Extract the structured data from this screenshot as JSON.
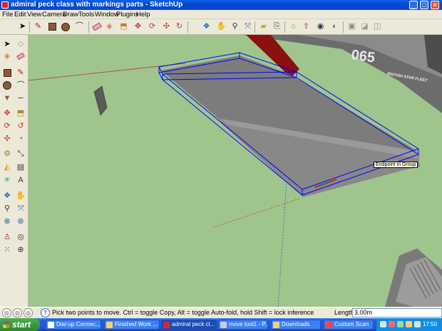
{
  "window": {
    "title": "admiral peck class with markings parts - SketchUp",
    "minimize": "_",
    "maximize": "□",
    "close": "✕"
  },
  "menu": [
    "File",
    "Edit",
    "View",
    "Camera",
    "Draw",
    "Tools",
    "Window",
    "Plugins",
    "Help"
  ],
  "toolbar": {
    "icons": [
      "select-icon",
      "pencil-line-icon",
      "rectangle-icon",
      "circle-icon",
      "arc-icon",
      "eraser-icon",
      "paint-bucket-icon",
      "push-pull-icon",
      "move-icon",
      "rotate-icon",
      "follow-me-icon",
      "orbit-icon",
      "pan-icon",
      "zoom-icon",
      "zoom-extents-icon",
      "open-icon",
      "save-icon",
      "get-models-icon",
      "share-model-icon",
      "google-earth-icon",
      "component-icon",
      "style-icon"
    ]
  },
  "left_toolbar": {
    "icons": [
      "select-icon",
      "make-component-icon",
      "paint-bucket-icon",
      "eraser-icon",
      "rectangle-icon",
      "line-icon",
      "circle-icon",
      "arc-icon",
      "polygon-icon",
      "freehand-icon",
      "move-icon",
      "push-pull-icon",
      "rotate-icon",
      "follow-me-icon",
      "scale-icon",
      "offset-icon",
      "tape-measure-icon",
      "dimension-icon",
      "protractor-icon",
      "text-icon",
      "axes-icon",
      "3d-text-icon",
      "orbit-icon",
      "pan-icon",
      "zoom-icon",
      "zoom-window-icon",
      "zoom-extents-icon",
      "previous-view-icon",
      "position-camera-icon",
      "look-around-icon",
      "walk-icon",
      "section-plane-icon"
    ]
  },
  "viewport": {
    "tooltip": "Endpoint in Group",
    "hull_number": "065",
    "hull_text": "BRITISH STAR FLEET",
    "background_color": "#9fc58d",
    "selection_color": "#0000ff"
  },
  "status": {
    "message": "Pick two points to move.  Ctrl = toggle Copy, Alt = toggle Auto-fold, hold Shift = lock inference",
    "length_label": "Length",
    "length_value": "3.00m",
    "help_icon": "?"
  },
  "taskbar": {
    "start_label": "start",
    "tasks": [
      "Dial-up Connec...",
      "Finished Work ...",
      "admiral peck cl...",
      "move tool1 - P...",
      "Downloads",
      "Custom Scan"
    ],
    "active_task": "admiral peck cl...",
    "clock": "17:50"
  }
}
